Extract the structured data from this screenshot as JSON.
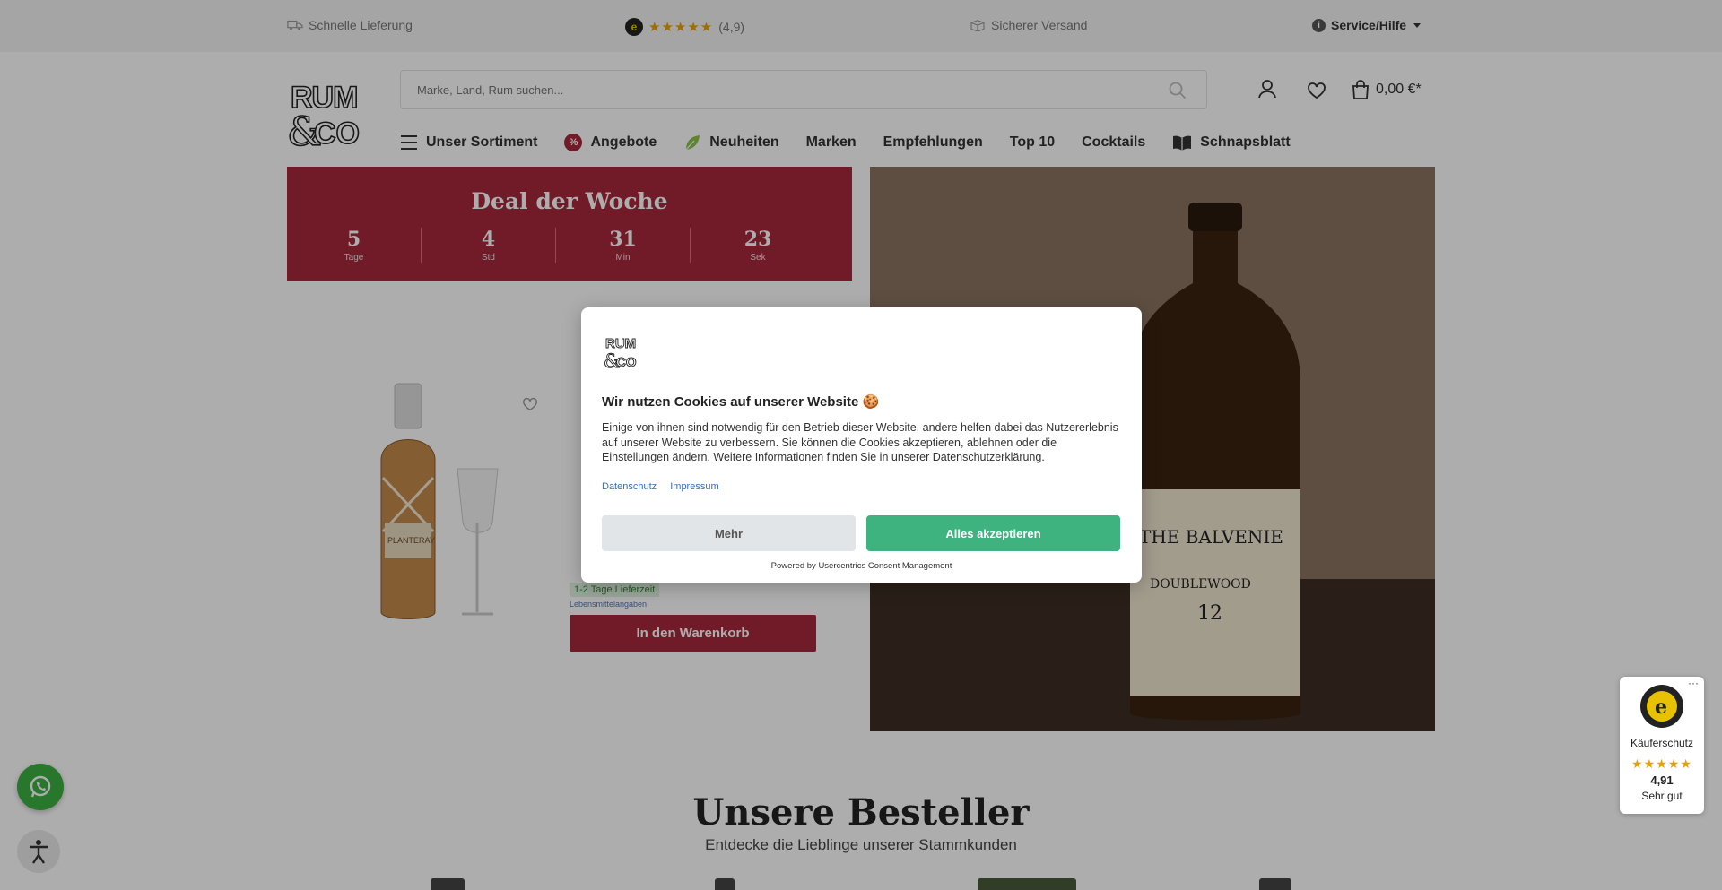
{
  "topbar": {
    "delivery": "Schnelle Lieferung",
    "rating": "(4,9)",
    "shipping": "Sicherer Versand",
    "service": "Service/Hilfe"
  },
  "header": {
    "search_placeholder": "Marke, Land, Rum suchen...",
    "cart_total": "0,00 €*"
  },
  "nav": {
    "items": [
      "Unser Sortiment",
      "Angebote",
      "Neuheiten",
      "Marken",
      "Empfehlungen",
      "Top 10",
      "Cocktails",
      "Schnapsblatt"
    ]
  },
  "deal": {
    "title": "Deal der Woche",
    "countdown": [
      {
        "value": "5",
        "label": "Tage"
      },
      {
        "value": "4",
        "label": "Std"
      },
      {
        "value": "31",
        "label": "Min"
      },
      {
        "value": "23",
        "label": "Sek"
      }
    ],
    "delivery_badge": "1-2 Tage Lieferzeit",
    "food_info": "Lebensmittelangaben",
    "add_to_cart": "In den Warenkorb"
  },
  "bestseller": {
    "title": "Unsere Besteller",
    "subtitle": "Entdecke die Lieblinge unserer Stammkunden"
  },
  "cookie": {
    "title": "Wir nutzen Cookies auf unserer Website 🍪",
    "text": "Einige von ihnen sind notwendig für den Betrieb dieser Website, andere helfen dabei das Nutzererlebnis auf unserer Website zu verbessern. Sie können die Cookies akzeptieren, ablehnen oder die Einstellungen ändern. Weitere Informationen finden Sie in unserer Datenschutzerklärung.",
    "link_privacy": "Datenschutz",
    "link_imprint": "Impressum",
    "btn_more": "Mehr",
    "btn_accept": "Alles akzeptieren",
    "powered": "Powered by Usercentrics Consent Management"
  },
  "trusted_shops": {
    "label": "Käuferschutz",
    "score": "4,91",
    "grade": "Sehr gut"
  },
  "colors": {
    "brand_red": "#a8283c",
    "accept_green": "#3fb37f",
    "whatsapp_green": "#3cb043"
  }
}
